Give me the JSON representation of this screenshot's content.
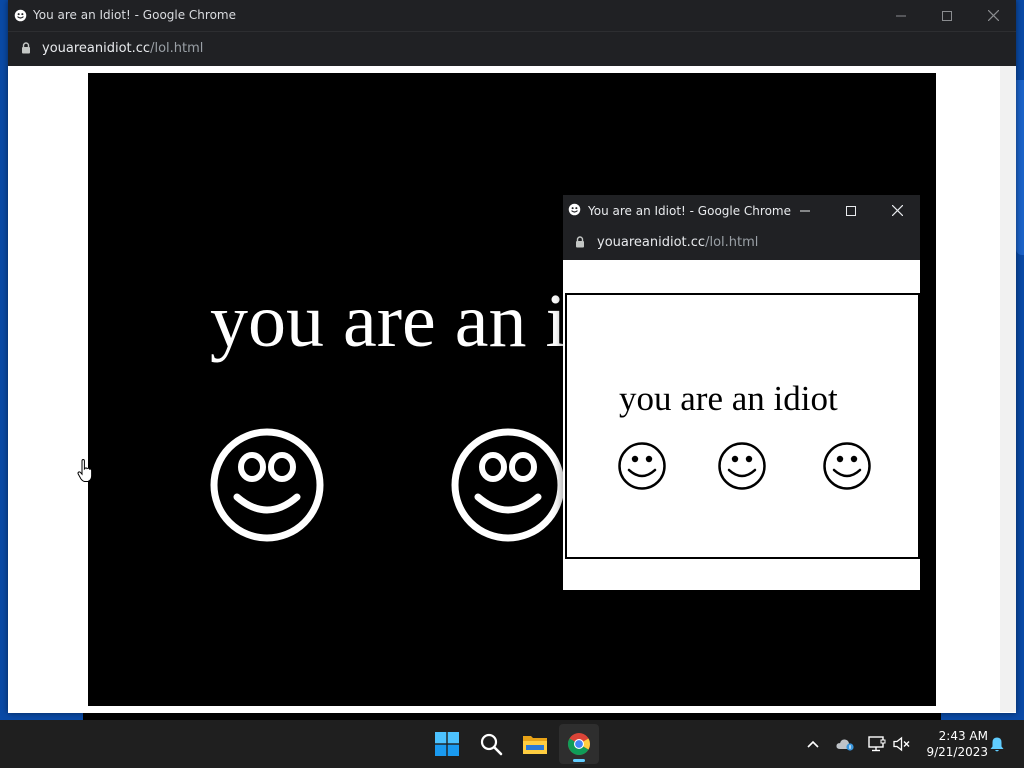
{
  "main_window": {
    "title": "You are an Idiot! - Google Chrome",
    "url_host": "youareanidiot.cc",
    "url_path": "/lol.html",
    "message": "you are an idiot",
    "icons": [
      "smiley-icon",
      "smiley-icon",
      "smiley-icon"
    ]
  },
  "popup_window": {
    "title": "You are an Idiot! - Google Chrome",
    "url_host": "youareanidiot.cc",
    "url_path": "/lol.html",
    "message": "you are an idiot",
    "icons": [
      "smiley-icon",
      "smiley-icon",
      "smiley-icon"
    ]
  },
  "taskbar": {
    "apps": [
      "start-icon",
      "search-icon",
      "file-explorer-icon",
      "chrome-icon"
    ],
    "active_app": "chrome-icon",
    "tray_icons": [
      "chevron-up-icon",
      "onedrive-icon",
      "network-icon",
      "volume-muted-icon",
      "notification-bell-icon"
    ],
    "time": "2:43 AM",
    "date": "9/21/2023"
  },
  "colors": {
    "desktop": "#0a4aa6",
    "chrome_frame": "#202124",
    "taskbar": "#1f1f1f",
    "accent": "#60cdff"
  }
}
